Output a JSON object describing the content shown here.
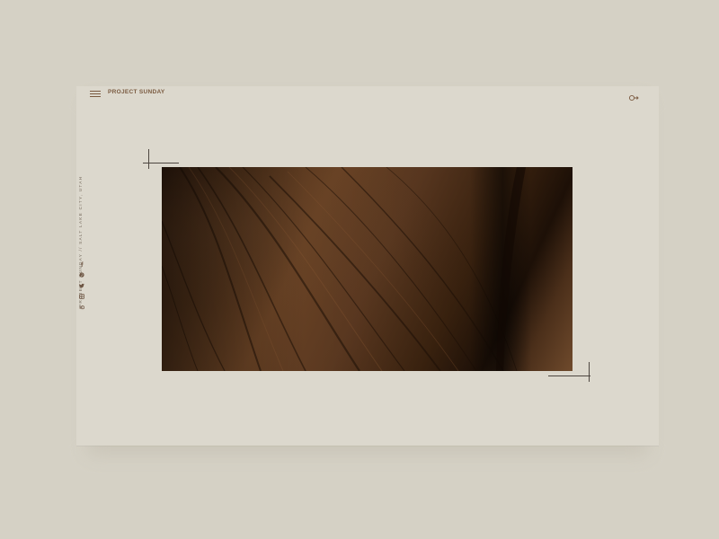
{
  "brand": "PROJECT SUNDAY",
  "side_tagline": "PROJECT SUNDAY // SALT LAKE CITY, UTAH",
  "nav": {
    "menu_icon": "hamburger-icon",
    "account_icon": "account-switch-icon"
  },
  "socials": [
    {
      "icon": "facebook-icon"
    },
    {
      "icon": "pinterest-icon"
    },
    {
      "icon": "twitter-icon"
    },
    {
      "icon": "instagram-icon"
    },
    {
      "icon": "soundcloud-icon"
    }
  ],
  "hero": {
    "description": "wood-grain-macro-image"
  },
  "colors": {
    "page_bg": "#d5d1c5",
    "window_bg": "#dcd8cd",
    "accent": "#7a5a40"
  }
}
